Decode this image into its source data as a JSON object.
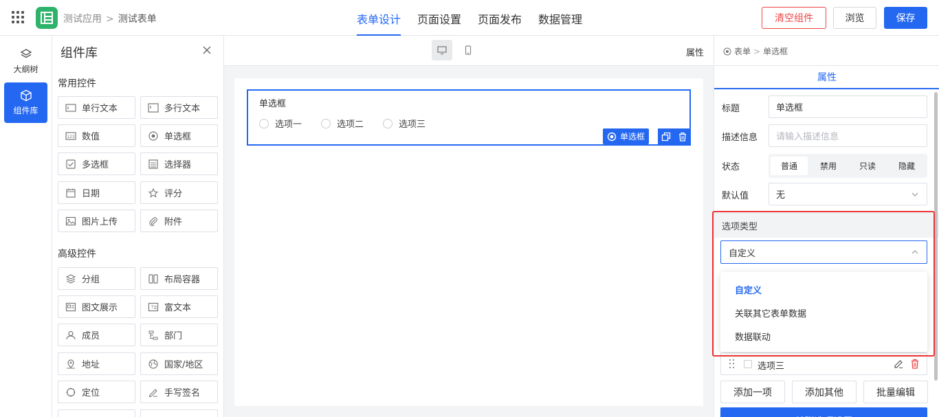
{
  "topbar": {
    "app_name": "测试应用",
    "form_name": "测试表单",
    "crumb_sep": ">",
    "tabs": [
      {
        "label": "表单设计",
        "active": true
      },
      {
        "label": "页面设置",
        "active": false
      },
      {
        "label": "页面发布",
        "active": false
      },
      {
        "label": "数据管理",
        "active": false
      }
    ],
    "clear_label": "清空组件",
    "preview_label": "浏览",
    "save_label": "保存"
  },
  "rail": {
    "outline_label": "大纲树",
    "library_label": "组件库"
  },
  "library": {
    "title": "组件库",
    "common_title": "常用控件",
    "advanced_title": "高级控件",
    "common": [
      "单行文本",
      "多行文本",
      "数值",
      "单选框",
      "多选框",
      "选择器",
      "日期",
      "评分",
      "图片上传",
      "附件"
    ],
    "advanced": [
      "分组",
      "布局容器",
      "图文展示",
      "富文本",
      "成员",
      "部门",
      "地址",
      "国家/地区",
      "定位",
      "手写签名"
    ]
  },
  "canvas": {
    "prop_link": "属性",
    "field": {
      "label": "单选框",
      "options": [
        "选项一",
        "选项二",
        "选项三"
      ],
      "tag": "单选框"
    }
  },
  "panel": {
    "crumb_root": "表单",
    "crumb_sep": ">",
    "crumb_current": "单选框",
    "tab": "属性",
    "title_label": "标题",
    "title_value": "单选框",
    "desc_label": "描述信息",
    "desc_placeholder": "请输入描述信息",
    "status_label": "状态",
    "status_options": [
      "普通",
      "禁用",
      "只读",
      "隐藏"
    ],
    "status_selected": "普通",
    "default_label": "默认值",
    "default_value": "无",
    "option_type_label": "选项类型",
    "option_type_value": "自定义",
    "dropdown": [
      "自定义",
      "关联其它表单数据",
      "数据联动"
    ],
    "option_row": "选项三",
    "btn_add": "添加一项",
    "btn_other": "添加其他",
    "btn_batch": "批量编辑",
    "btn_assoc": "关联选项设置"
  },
  "colors": {
    "accent": "#2468f2",
    "danger": "#e44444",
    "logo": "#2fb36b"
  }
}
